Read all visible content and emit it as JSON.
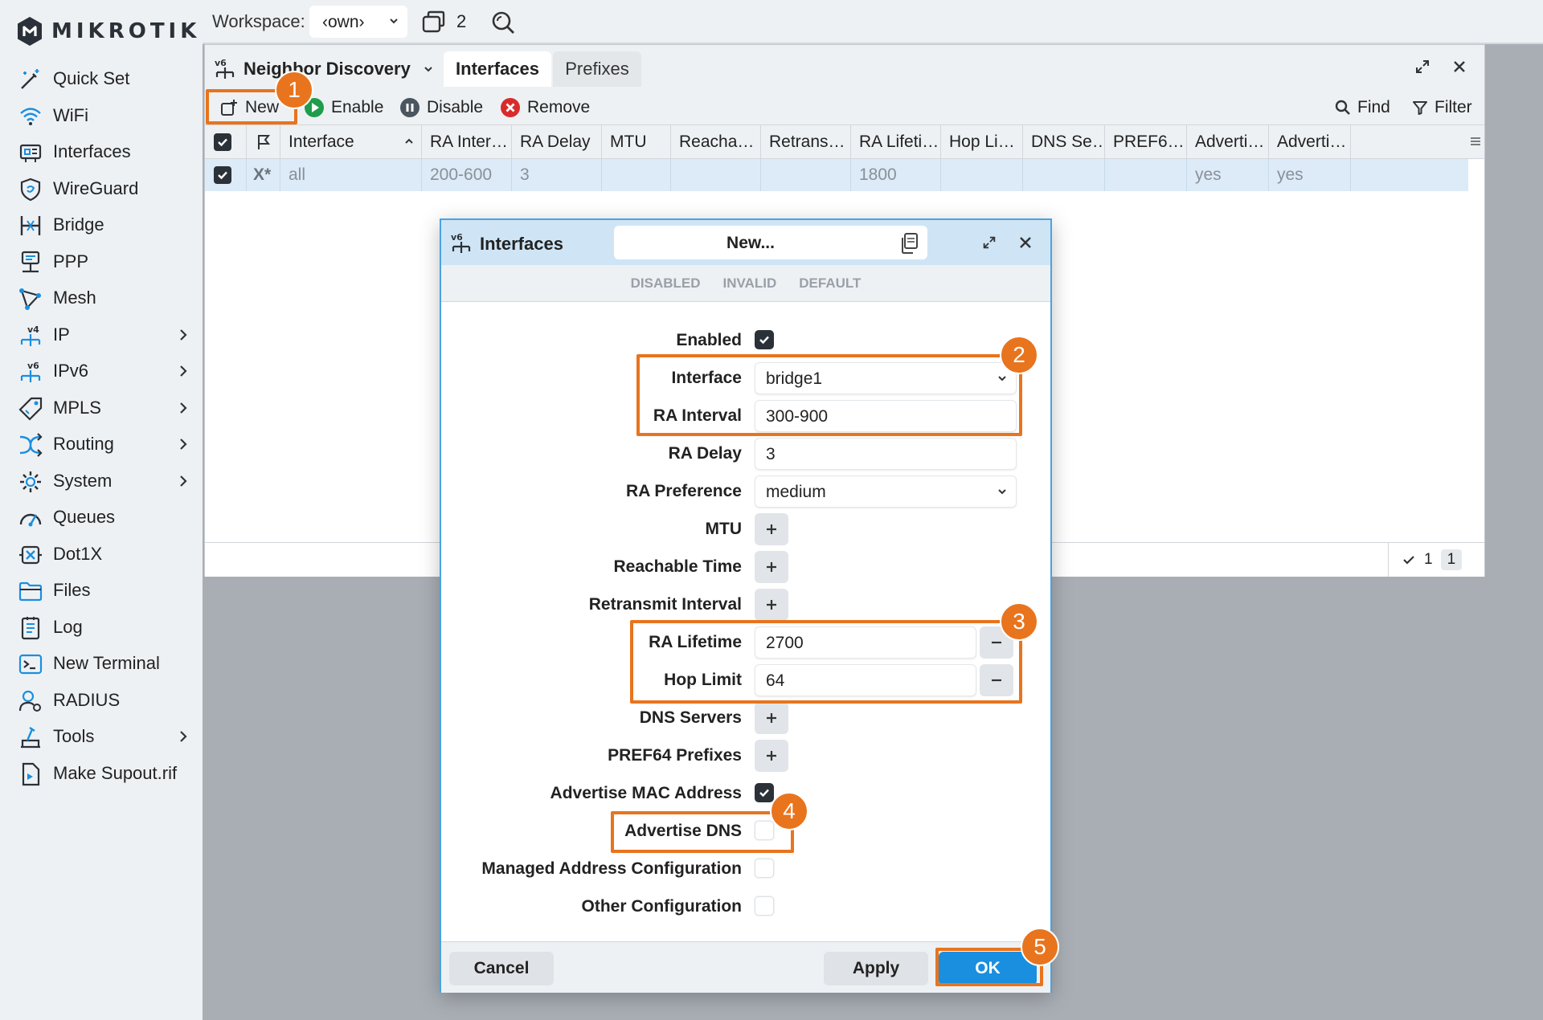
{
  "brand": {
    "name": "MIKROTIK",
    "accent": "#1a8fe0",
    "annotation_color": "#e8741e"
  },
  "topbar": {
    "workspace_label": "Workspace:",
    "workspace_value": "‹own›",
    "window_count": "2"
  },
  "sidebar": {
    "items": [
      {
        "label": "Quick Set",
        "icon": "magic-wand-icon",
        "submenu": false
      },
      {
        "label": "WiFi",
        "icon": "wifi-icon",
        "submenu": false
      },
      {
        "label": "Interfaces",
        "icon": "interfaces-icon",
        "submenu": false
      },
      {
        "label": "WireGuard",
        "icon": "wireguard-shield-icon",
        "submenu": false
      },
      {
        "label": "Bridge",
        "icon": "bridge-icon",
        "submenu": false
      },
      {
        "label": "PPP",
        "icon": "ppp-icon",
        "submenu": false
      },
      {
        "label": "Mesh",
        "icon": "mesh-icon",
        "submenu": false
      },
      {
        "label": "IP",
        "icon": "ipv4-icon",
        "submenu": true
      },
      {
        "label": "IPv6",
        "icon": "ipv6-icon",
        "submenu": true
      },
      {
        "label": "MPLS",
        "icon": "mpls-tag-icon",
        "submenu": true
      },
      {
        "label": "Routing",
        "icon": "routing-icon",
        "submenu": true
      },
      {
        "label": "System",
        "icon": "gear-icon",
        "submenu": true
      },
      {
        "label": "Queues",
        "icon": "gauge-icon",
        "submenu": false
      },
      {
        "label": "Dot1X",
        "icon": "dot1x-icon",
        "submenu": false
      },
      {
        "label": "Files",
        "icon": "folder-icon",
        "submenu": false
      },
      {
        "label": "Log",
        "icon": "log-icon",
        "submenu": false
      },
      {
        "label": "New Terminal",
        "icon": "terminal-icon",
        "submenu": false
      },
      {
        "label": "RADIUS",
        "icon": "radius-user-icon",
        "submenu": false
      },
      {
        "label": "Tools",
        "icon": "tools-icon",
        "submenu": true
      },
      {
        "label": "Make Supout.rif",
        "icon": "file-export-icon",
        "submenu": false
      }
    ]
  },
  "window": {
    "title": "Neighbor Discovery",
    "tabs": [
      "Interfaces",
      "Prefixes"
    ],
    "toolbar": {
      "new": "New",
      "enable": "Enable",
      "disable": "Disable",
      "remove": "Remove",
      "find": "Find",
      "filter": "Filter"
    },
    "columns": [
      "Interface",
      "RA Inter…",
      "RA Delay",
      "MTU",
      "Reacha…",
      "Retrans…",
      "RA Lifeti…",
      "Hop Li…",
      "DNS Se…",
      "PREF6…",
      "Adverti…",
      "Adverti…"
    ],
    "rows": [
      {
        "flags": "X*",
        "interface": "all",
        "ra_interval": "200-600",
        "ra_delay": "3",
        "mtu": "",
        "reachable": "",
        "retransmit": "",
        "ra_lifetime": "1800",
        "hop_limit": "",
        "dns": "",
        "pref64": "",
        "adv_mac": "yes",
        "adv_dns": "yes"
      }
    ],
    "status": {
      "selected": "1",
      "total": "1"
    }
  },
  "dialog": {
    "title": "Interfaces",
    "name": "New...",
    "status_flags": [
      "DISABLED",
      "INVALID",
      "DEFAULT"
    ],
    "fields": {
      "enabled": {
        "label": "Enabled",
        "checked": true
      },
      "interface": {
        "label": "Interface",
        "value": "bridge1"
      },
      "ra_interval": {
        "label": "RA Interval",
        "value": "300-900"
      },
      "ra_delay": {
        "label": "RA Delay",
        "value": "3"
      },
      "ra_preference": {
        "label": "RA Preference",
        "value": "medium"
      },
      "mtu": {
        "label": "MTU"
      },
      "reachable_time": {
        "label": "Reachable Time"
      },
      "retransmit_interval": {
        "label": "Retransmit Interval"
      },
      "ra_lifetime": {
        "label": "RA Lifetime",
        "value": "2700"
      },
      "hop_limit": {
        "label": "Hop Limit",
        "value": "64"
      },
      "dns_servers": {
        "label": "DNS Servers"
      },
      "pref64_prefixes": {
        "label": "PREF64 Prefixes"
      },
      "advertise_mac": {
        "label": "Advertise MAC Address",
        "checked": true
      },
      "advertise_dns": {
        "label": "Advertise DNS",
        "checked": false
      },
      "managed_address": {
        "label": "Managed Address Configuration",
        "checked": false
      },
      "other_config": {
        "label": "Other Configuration",
        "checked": false
      }
    },
    "buttons": {
      "cancel": "Cancel",
      "apply": "Apply",
      "ok": "OK"
    }
  },
  "annotations": [
    "1",
    "2",
    "3",
    "4",
    "5"
  ]
}
